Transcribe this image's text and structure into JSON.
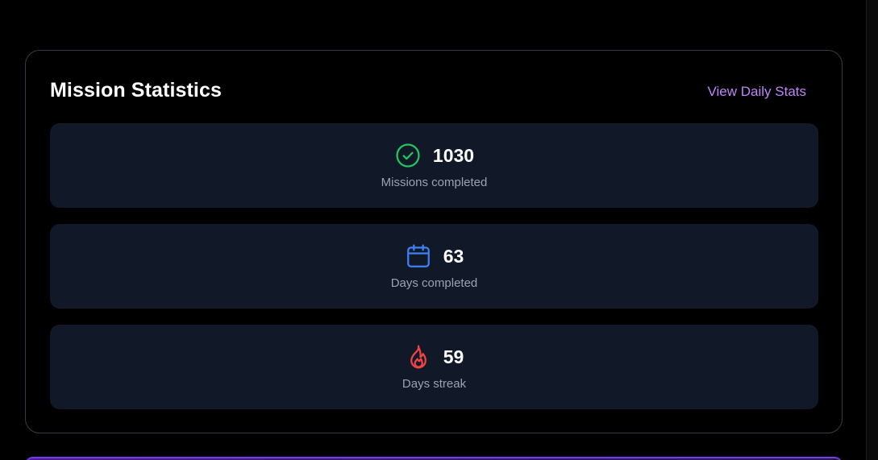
{
  "card": {
    "title": "Mission Statistics",
    "link_label": "View Daily Stats"
  },
  "stats": [
    {
      "icon": "check-circle-icon",
      "value": "1030",
      "label": "Missions completed",
      "color": "#22c55e"
    },
    {
      "icon": "calendar-icon",
      "value": "63",
      "label": "Days completed",
      "color": "#3b82f6"
    },
    {
      "icon": "flame-icon",
      "value": "59",
      "label": "Days streak",
      "color": "#ef4444"
    }
  ],
  "colors": {
    "background": "#000000",
    "panel": "#111827",
    "accent": "#c084fc"
  }
}
